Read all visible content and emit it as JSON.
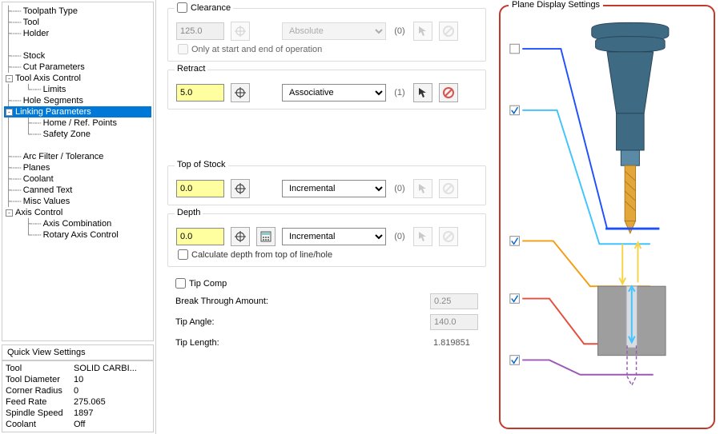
{
  "tree": {
    "items": [
      "Toolpath Type",
      "Tool",
      "Holder",
      "",
      "Stock",
      "Cut Parameters",
      "Tool Axis Control",
      "Limits",
      "Hole Segments",
      "Linking Parameters",
      "Home / Ref. Points",
      "Safety Zone",
      "",
      "Arc Filter / Tolerance",
      "Planes",
      "Coolant",
      "Canned Text",
      "Misc Values",
      "Axis Control",
      "Axis Combination",
      "Rotary Axis Control"
    ]
  },
  "quick_view": {
    "title": "Quick View Settings",
    "rows": [
      {
        "label": "Tool",
        "value": "SOLID CARBI..."
      },
      {
        "label": "Tool Diameter",
        "value": "10"
      },
      {
        "label": "Corner Radius",
        "value": "0"
      },
      {
        "label": "Feed Rate",
        "value": "275.065"
      },
      {
        "label": "Spindle Speed",
        "value": "1897"
      },
      {
        "label": "Coolant",
        "value": "Off"
      }
    ]
  },
  "params": {
    "clearance": {
      "label": "Clearance",
      "value": "125.0",
      "mode": "Absolute",
      "count": "(0)",
      "only_label": "Only at start and end of operation"
    },
    "retract": {
      "label": "Retract",
      "value": "5.0",
      "mode": "Associative",
      "count": "(1)"
    },
    "top": {
      "label": "Top of Stock",
      "value": "0.0",
      "mode": "Incremental",
      "count": "(0)"
    },
    "depth": {
      "label": "Depth",
      "value": "0.0",
      "mode": "Incremental",
      "count": "(0)",
      "calc_label": "Calculate depth from top of line/hole"
    },
    "tip": {
      "label": "Tip Comp",
      "break_label": "Break Through Amount:",
      "break_val": "0.25",
      "angle_label": "Tip Angle:",
      "angle_val": "140.0",
      "len_label": "Tip Length:",
      "len_val": "1.819851"
    }
  },
  "pds": {
    "title": "Plane Display Settings"
  }
}
